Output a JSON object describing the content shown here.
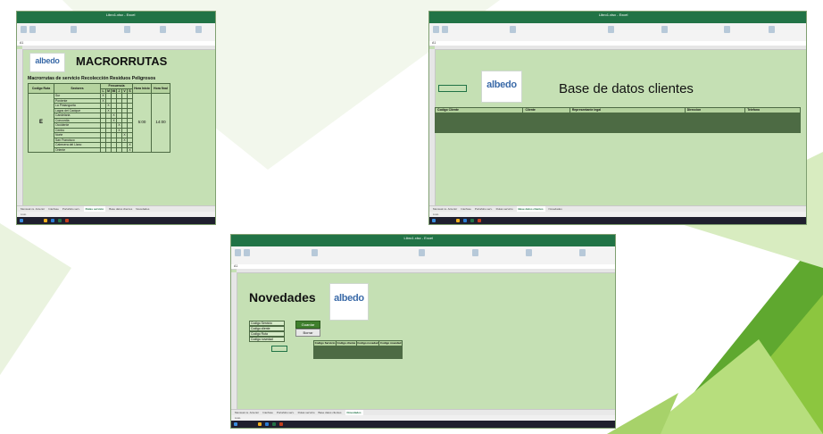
{
  "app": {
    "window_title": "Libro1.xlsx - Excel",
    "ribbon_tabs": [
      "Archivo",
      "Inicio",
      "Insertar",
      "Disposición de página",
      "Fórmulas",
      "Datos",
      "Revisar",
      "Vista",
      "Ayuda",
      "¿Qué desea hacer?"
    ],
    "status": "Listo"
  },
  "macrorrutas": {
    "name_box": "A1",
    "logo_text": "albedo",
    "title": "MACRORRUTAS",
    "subtitle": "Macrorrutas de servicio Recolección Residuos Peligrosos",
    "headers": [
      "Codigo Ruta",
      "Sectores",
      "Frecuencia",
      "Hora Inicio",
      "Hora final"
    ],
    "frequency_days": [
      "L",
      "M",
      "MI",
      "J",
      "V",
      "S"
    ],
    "route_code": "E",
    "start_time": "5:00",
    "end_time": "14:00",
    "sectors": [
      "Sur",
      "Poniente",
      "La Pintangueta",
      "Lagos del Cacique",
      "Candelaria",
      "Concordia",
      "Occidente",
      "Centro",
      "Norte",
      "San Francisco",
      "Cabecera del Llano",
      "Oriente"
    ],
    "marks": [
      0,
      0,
      1,
      1,
      2,
      2,
      3,
      3,
      4,
      4,
      5,
      5
    ],
    "sheet_tabs": [
      "Mensual vs. Anterior",
      "Interfase",
      "Portafolio serv.",
      "Rutas servicio",
      "Base datos clientes",
      "Novedades"
    ],
    "active_sheet": "Rutas servicio"
  },
  "clientes": {
    "name_box": "A1",
    "logo_text": "albedo",
    "title": "Base de datos clientes",
    "headers": [
      "Codigo Cliente",
      "Cliente",
      "Representante legal",
      "Direccion",
      "Telefono"
    ],
    "sheet_tabs": [
      "Mensual vs. Anterior",
      "Interfase",
      "Portafolio serv.",
      "Rutas servicio",
      "Base datos clientes",
      "Novedades"
    ],
    "active_sheet": "Base datos clientes"
  },
  "novedades": {
    "name_box": "A1",
    "logo_text": "albedo",
    "title": "Novedades",
    "form_labels": [
      "Codigo Servicio",
      "Codigo cliente",
      "Codigo Ruta",
      "Codigo novedad"
    ],
    "buttons": [
      "Guardar",
      "Borrar"
    ],
    "headers": [
      "Codigo Servicio",
      "Codigo cliente",
      "Codigo novedad",
      "Codigo novedad"
    ],
    "sheet_tabs": [
      "Mensual vs. Anterior",
      "Interfase",
      "Portafolio serv.",
      "Rutas servicio",
      "Base datos clientes",
      "Novedades"
    ],
    "active_sheet": "Novedades"
  },
  "colors": {
    "excel_green": "#217346",
    "sheet_bg": "#c5e0b4",
    "deco_greens": [
      "#8cc63f",
      "#5fa82f",
      "#b7de7d"
    ]
  }
}
